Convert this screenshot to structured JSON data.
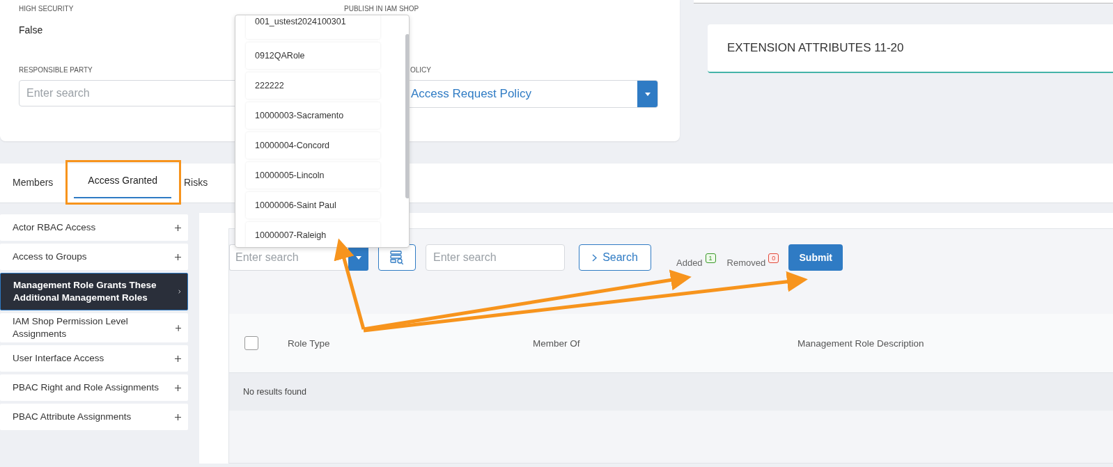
{
  "details": {
    "fields": [
      {
        "label": "HIGH SECURITY",
        "value": "False"
      },
      {
        "label": "PUBLISH IN IAM SHOP"
      }
    ],
    "responsible_party": {
      "label": "RESPONSIBLE PARTY",
      "placeholder": "Enter search"
    },
    "policy": {
      "label": "OLICY",
      "value": "Access Request Policy"
    }
  },
  "extension_card": {
    "title": "EXTENSION ATTRIBUTES 11-20"
  },
  "tabs": [
    {
      "label": "Members",
      "selected": false
    },
    {
      "label": "Access Granted",
      "selected": true
    },
    {
      "label": "Risks",
      "selected": false
    }
  ],
  "sidebar": {
    "items": [
      {
        "label": "Actor RBAC Access",
        "selected": false
      },
      {
        "label": "Access to Groups",
        "selected": false
      },
      {
        "label": "Management Role Grants These Additional Management Roles",
        "selected": true
      },
      {
        "label": "IAM Shop Permission Level Assignments",
        "selected": false
      },
      {
        "label": "User Interface Access",
        "selected": false
      },
      {
        "label": "PBAC Right and Role Assignments",
        "selected": false
      },
      {
        "label": "PBAC Attribute Assignments",
        "selected": false
      }
    ]
  },
  "toolbar": {
    "role_select": {
      "placeholder": "Enter search"
    },
    "search_field": {
      "placeholder": "Enter search"
    },
    "search_button": "Search",
    "counters": [
      {
        "kind": "added",
        "label": "Added",
        "count": "1"
      },
      {
        "kind": "removed",
        "label": "Removed",
        "count": "0"
      }
    ],
    "submit_button": "Submit"
  },
  "table": {
    "select_all": {
      "checked": false
    },
    "columns": [
      "Role Type",
      "Member Of",
      "Management Role Description"
    ],
    "empty_message": "No results found"
  },
  "dropdown": {
    "options": [
      "001_ustest2024100301",
      "0912QARole",
      "222222",
      "10000003-Sacramento",
      "10000004-Concord",
      "10000005-Lincoln",
      "10000006-Saint Paul",
      "10000007-Raleigh"
    ]
  }
}
